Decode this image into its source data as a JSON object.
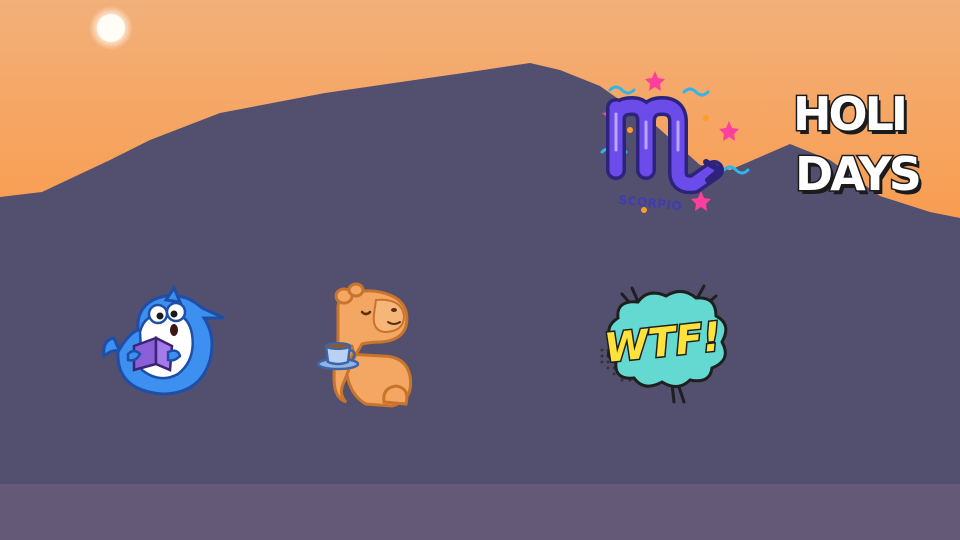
{
  "scene": {
    "sky_top": "#f2b07a",
    "sky_bottom": "#fb9b47",
    "sun": "#fff6df",
    "mountain": "#534f6f",
    "ground_strip": "#645a78"
  },
  "stickers": {
    "scorpio": {
      "icon": "scorpio-zodiac-icon",
      "label": "SCORPIO",
      "accent": "#5b3fd6"
    },
    "holidays": {
      "icon": "holidays-lettering-icon",
      "line1": "HOLI",
      "line2": "DAYS"
    },
    "shark": {
      "icon": "shark-reading-book-icon",
      "color": "#3d8ff0"
    },
    "capybara": {
      "icon": "capybara-with-tea-icon",
      "color": "#f3a763"
    },
    "wtf": {
      "icon": "wtf-speech-bubble-icon",
      "label": "WTF!",
      "bubble": "#64d9d2"
    }
  }
}
